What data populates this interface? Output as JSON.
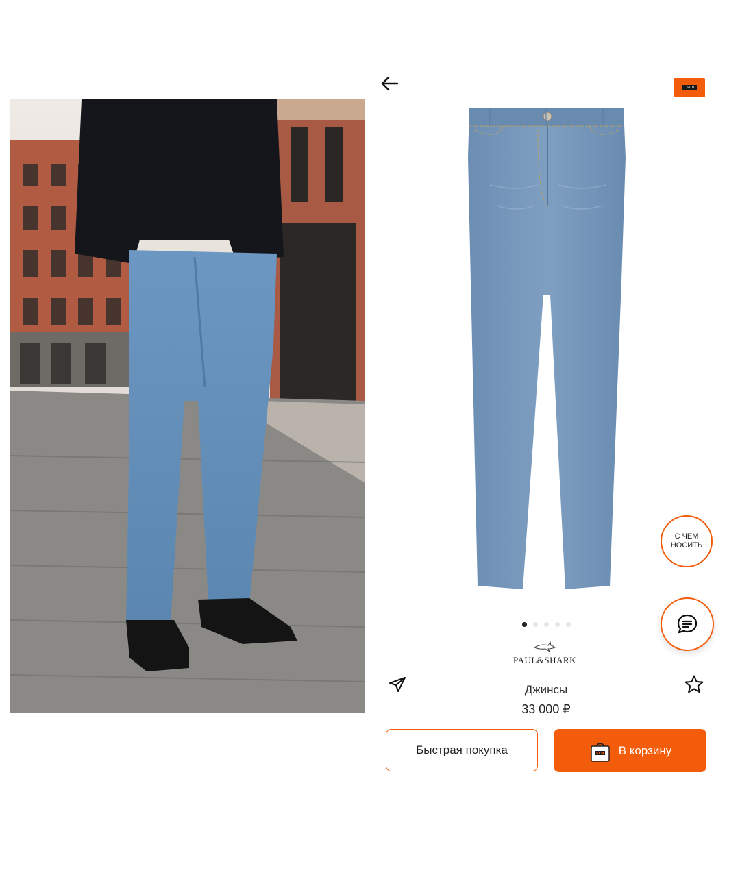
{
  "header": {
    "back_icon": "arrow-left-icon",
    "brand_badge_text": "TSUM",
    "accent_color": "#f25c0a"
  },
  "gallery": {
    "total_dots": 5,
    "active_index": 0
  },
  "fab": {
    "outfit_line1": "С ЧЕМ",
    "outfit_line2": "НОСИТЬ",
    "chat_icon": "chat-bubble-icon"
  },
  "product": {
    "brand": "PAUL&SHARK",
    "name": "Джинсы",
    "price": "33 000 ₽"
  },
  "actions": {
    "share_icon": "send-paper-plane-icon",
    "favorite_icon": "star-outline-icon",
    "quick_buy_label": "Быстрая покупка",
    "add_to_cart_label": "В корзину",
    "cart_icon": "shopping-bag-icon"
  }
}
